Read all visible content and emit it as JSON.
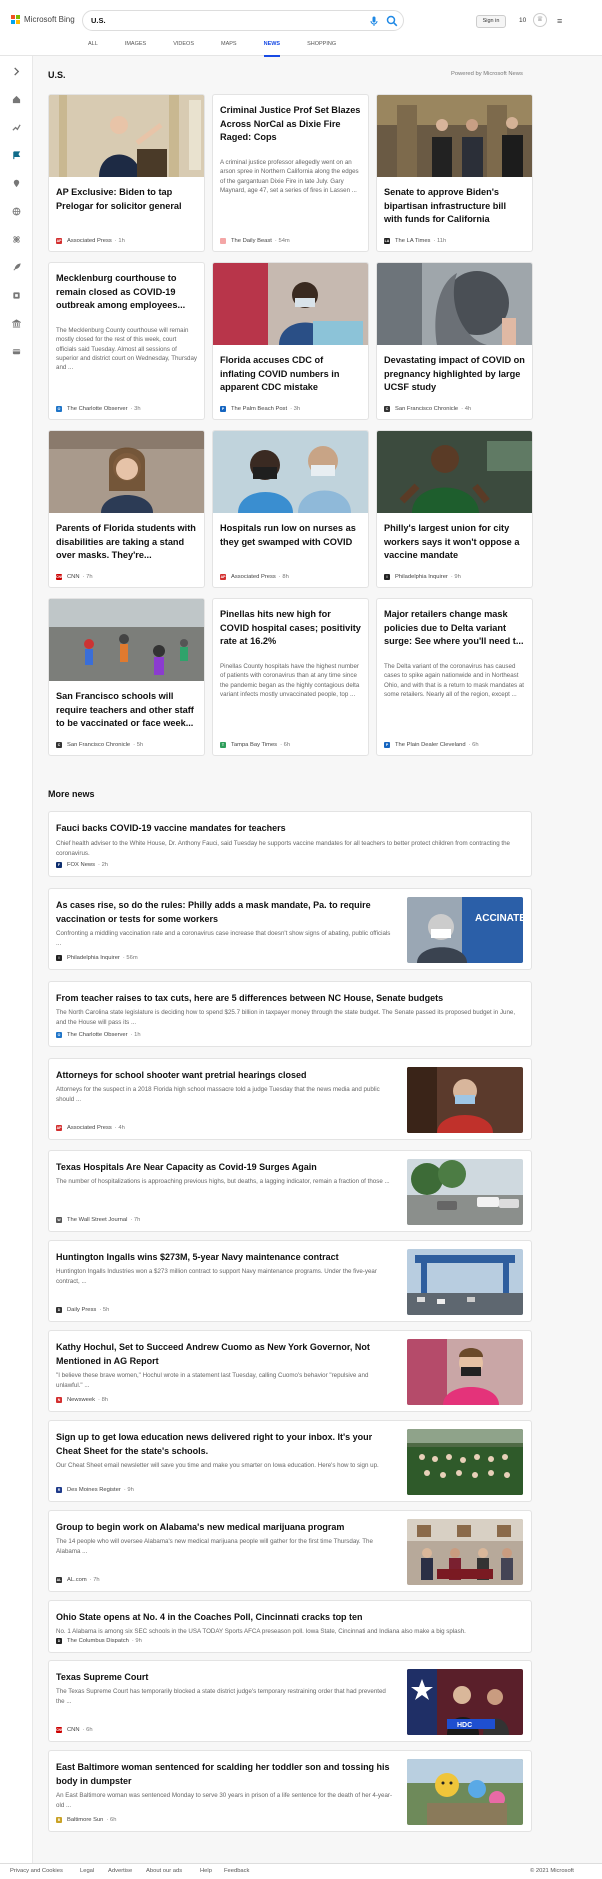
{
  "brand": {
    "name": "Microsoft Bing",
    "colors": [
      "#f25022",
      "#7fba00",
      "#00a4ef",
      "#ffb900"
    ]
  },
  "search": {
    "value": "U.S."
  },
  "header": {
    "sign_in": "Sign in",
    "points": "10"
  },
  "tabs": [
    "ALL",
    "IMAGES",
    "VIDEOS",
    "MAPS",
    "NEWS",
    "SHOPPING"
  ],
  "active_tab": "NEWS",
  "section": {
    "title": "U.S.",
    "powered_by": "Powered by Microsoft News"
  },
  "cards": [
    {
      "title": "AP Exclusive: Biden to tap Prelogar for solicitor general",
      "source": "Associated Press",
      "time": "1h",
      "fav": "#d32f2f",
      "fav_text": "AP"
    },
    {
      "title": "Criminal Justice Prof Set Blazes Across NorCal as Dixie Fire Raged: Cops",
      "snippet": "A criminal justice professor allegedly went on an arson spree in Northern California along the edges of the gargantuan Dixie Fire in late July. Gary Maynard, age 47, set a series of fires in Lassen ...",
      "source": "The Daily Beast",
      "time": "54m",
      "fav": "#f4a6a6",
      "fav_text": ""
    },
    {
      "title": "Senate to approve Biden's bipartisan infrastructure bill with funds for California",
      "source": "The LA Times",
      "time": "11h",
      "fav": "#222",
      "fav_text": "LA"
    },
    {
      "title": "Mecklenburg courthouse to remain closed as COVID-19 outbreak among employees...",
      "snippet": "The Mecklenburg County courthouse will remain mostly closed for the rest of this week, court officials said Tuesday. Almost all sessions of superior and district court on Wednesday, Thursday and ...",
      "source": "The Charlotte Observer",
      "time": "3h",
      "fav": "#1e74c8",
      "fav_text": "O"
    },
    {
      "title": "Florida accuses CDC of inflating COVID numbers in apparent CDC mistake",
      "source": "The Palm Beach Post",
      "time": "3h",
      "fav": "#1565c0",
      "fav_text": "P"
    },
    {
      "title": "Devastating impact of COVID on pregnancy highlighted by large UCSF study",
      "source": "San Francisco Chronicle",
      "time": "4h",
      "fav": "#333",
      "fav_text": "C"
    },
    {
      "title": "Parents of Florida students with disabilities are taking a stand over masks. They're...",
      "source": "CNN",
      "time": "7h",
      "fav": "#cc0000",
      "fav_text": "CNN"
    },
    {
      "title": "Hospitals run low on nurses as they get swamped with COVID",
      "source": "Associated Press",
      "time": "8h",
      "fav": "#d32f2f",
      "fav_text": "AP"
    },
    {
      "title": "Philly's largest union for city workers says it won't oppose a vaccine mandate",
      "source": "Philadelphia Inquirer",
      "time": "9h",
      "fav": "#222",
      "fav_text": "I"
    },
    {
      "title": "San Francisco schools will require teachers and other staff to be vaccinated or face week...",
      "source": "San Francisco Chronicle",
      "time": "5h",
      "fav": "#333",
      "fav_text": "C"
    },
    {
      "title": "Pinellas hits new high for COVID hospital cases; positivity rate at 16.2%",
      "snippet": "Pinellas County hospitals have the highest number of patients with coronavirus than at any time since the pandemic began as the highly contagious delta variant infects mostly unvaccinated people, top ...",
      "source": "Tampa Bay Times",
      "time": "6h",
      "fav": "#2e9e5b",
      "fav_text": "T"
    },
    {
      "title": "Major retailers change mask policies due to Delta variant surge: See where you'll need t...",
      "snippet": "The Delta variant of the coronavirus has caused cases to spike again nationwide and in Northeast Ohio, and with that is a return to mask mandates at some retailers. Nearly all of the region, except ...",
      "source": "The Plain Dealer Cleveland",
      "time": "6h",
      "fav": "#1565c0",
      "fav_text": "P"
    }
  ],
  "more_news": {
    "title": "More news",
    "items": [
      {
        "title": "Fauci backs COVID-19 vaccine mandates for teachers",
        "snippet": "Chief health adviser to the White House, Dr. Anthony Fauci, said Tuesday he supports vaccine mandates for all teachers to better protect children from contracting the coronavirus.",
        "source": "FOX News",
        "time": "2h",
        "fav": "#0d2e6e",
        "fav_text": "F"
      },
      {
        "title": "As cases rise, so do the rules: Philly adds a mask mandate, Pa. to require vaccination or tests for some workers",
        "snippet": "Confronting a middling vaccination rate and a coronavirus case increase that doesn't show signs of abating, public officials ...",
        "source": "Philadelphia Inquirer",
        "time": "56m",
        "fav": "#222",
        "fav_text": "I"
      },
      {
        "title": "From teacher raises to tax cuts, here are 5 differences between NC House, Senate budgets",
        "snippet": "The North Carolina state legislature is deciding how to spend $25.7 billion in taxpayer money through the state budget. The Senate passed its proposed budget in June, and the House will pass its ...",
        "source": "The Charlotte Observer",
        "time": "1h",
        "fav": "#1e74c8",
        "fav_text": "O"
      },
      {
        "title": "Attorneys for school shooter want pretrial hearings closed",
        "snippet": "Attorneys for the suspect in a 2018 Florida high school massacre told a judge Tuesday that the news media and public should ...",
        "source": "Associated Press",
        "time": "4h",
        "fav": "#d32f2f",
        "fav_text": "AP"
      },
      {
        "title": "Texas Hospitals Are Near Capacity as Covid-19 Surges Again",
        "snippet": "The number of hospitalizations is approaching previous highs, but deaths, a lagging indicator, remain a fraction of those ...",
        "source": "The Wall Street Journal",
        "time": "7h",
        "fav": "#555",
        "fav_text": "W"
      },
      {
        "title": "Huntington Ingalls wins $273M, 5-year Navy maintenance contract",
        "snippet": "Huntington Ingalls Industries won a $273 million contract to support Navy maintenance programs. Under the five-year contract, ...",
        "source": "Daily Press",
        "time": "5h",
        "fav": "#333",
        "fav_text": "D"
      },
      {
        "title": "Kathy Hochul, Set to Succeed Andrew Cuomo as New York Governor, Not Mentioned in AG Report",
        "snippet": "\"I believe these brave women,\" Hochul wrote in a statement last Tuesday, calling Cuomo's behavior \"repulsive and unlawful.\" ...",
        "source": "Newsweek",
        "time": "8h",
        "fav": "#d32f2f",
        "fav_text": "N"
      },
      {
        "title": "Sign up to get Iowa education news delivered right to your inbox. It's your Cheat Sheet for the state's schools.",
        "snippet": "Our Cheat Sheet email newsletter will save you time and make you smarter on Iowa education. Here's how to sign up.",
        "source": "Des Moines Register",
        "time": "9h",
        "fav": "#1e3a8a",
        "fav_text": "R"
      },
      {
        "title": "Group to begin work on Alabama's new medical marijuana program",
        "snippet": "The 14 people who will oversee Alabama's new medical marijuana people will gather for the first time Thursday. The Alabama ...",
        "source": "AL.com",
        "time": "7h",
        "fav": "#333",
        "fav_text": "AL"
      },
      {
        "title": "Ohio State opens at No. 4 in the Coaches Poll, Cincinnati cracks top ten",
        "snippet": "No. 1 Alabama is among six SEC schools in the USA TODAY Sports AFCA preseason poll. Iowa State, Cincinnati and Indiana also make a big splash.",
        "source": "The Columbus Dispatch",
        "time": "9h",
        "fav": "#222",
        "fav_text": "D"
      },
      {
        "title": "Texas Supreme Court",
        "snippet": "The Texas Supreme Court has temporarily blocked a state district judge's temporary restraining order that had prevented the ...",
        "source": "CNN",
        "time": "6h",
        "fav": "#cc0000",
        "fav_text": "CNN"
      },
      {
        "title": "East Baltimore woman sentenced for scalding her toddler son and tossing his body in dumpster",
        "snippet": "An East Baltimore woman was sentenced Monday to serve 30 years in prison of a life sentence for the death of her 4-year-old ...",
        "source": "Baltimore Sun",
        "time": "6h",
        "fav": "#c9a227",
        "fav_text": "B"
      }
    ]
  },
  "footer": {
    "links": [
      "Privacy and Cookies",
      "Legal",
      "Advertise",
      "About our ads",
      "Help",
      "Feedback"
    ],
    "copyright": "© 2021 Microsoft"
  }
}
